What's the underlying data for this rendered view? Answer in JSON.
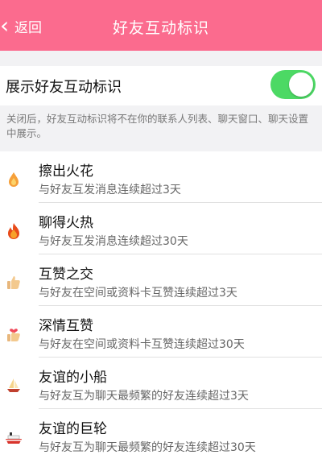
{
  "nav": {
    "back_label": "返回",
    "title": "好友互动标识"
  },
  "setting": {
    "label": "展示好友互动标识",
    "enabled": true,
    "description": "关闭后，好友互动标识将不在你的联系人列表、聊天窗口、聊天设置中展示。"
  },
  "colors": {
    "brand": "#fb6b8e",
    "toggle_on": "#4cd964"
  },
  "items": [
    {
      "title": "擦出火花",
      "subtitle": "与好友互发消息连续超过3天",
      "icon": "small-flame-icon"
    },
    {
      "title": "聊得火热",
      "subtitle": "与好友互发消息连续超过30天",
      "icon": "big-flame-icon"
    },
    {
      "title": "互赞之交",
      "subtitle": "与好友在空间或资料卡互赞连续超过3天",
      "icon": "thumbs-up-icon"
    },
    {
      "title": "深情互赞",
      "subtitle": "与好友在空间或资料卡互赞连续超过30天",
      "icon": "heart-thumbs-up-icon"
    },
    {
      "title": "友谊的小船",
      "subtitle": "与好友互为聊天最频繁的好友连续超过3天",
      "icon": "sailboat-icon"
    },
    {
      "title": "友谊的巨轮",
      "subtitle": "与好友互为聊天最频繁的好友连续超过30天",
      "icon": "cruise-ship-icon"
    }
  ]
}
